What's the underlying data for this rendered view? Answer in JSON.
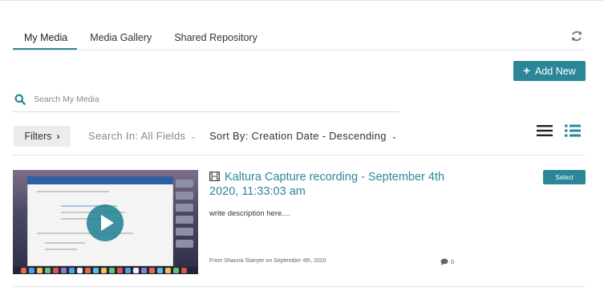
{
  "tabs": [
    {
      "label": "My Media",
      "active": true
    },
    {
      "label": "Media Gallery",
      "active": false
    },
    {
      "label": "Shared Repository",
      "active": false
    }
  ],
  "actions": {
    "add_new_label": "Add New",
    "refresh_icon": "refresh-icon"
  },
  "search": {
    "placeholder": "Search My Media",
    "value": ""
  },
  "filter_bar": {
    "filters_label": "Filters",
    "search_in_label": "Search In: All Fields",
    "sort_by_label": "Sort By: Creation Date - Descending",
    "view_modes": [
      "view-list-icon",
      "view-detail-icon"
    ]
  },
  "entries": [
    {
      "title": "Kaltura Capture recording - September 4th 2020, 11:33:03 am",
      "type_icon": "film-icon",
      "description": "write description here....",
      "meta": "From Shauna Stanyer on September 4th, 2020",
      "comment_count": "0",
      "select_label": "Select"
    }
  ],
  "colors": {
    "accent": "#2b8797",
    "filter_bg": "#ececec",
    "rule": "#e3e3e3"
  }
}
